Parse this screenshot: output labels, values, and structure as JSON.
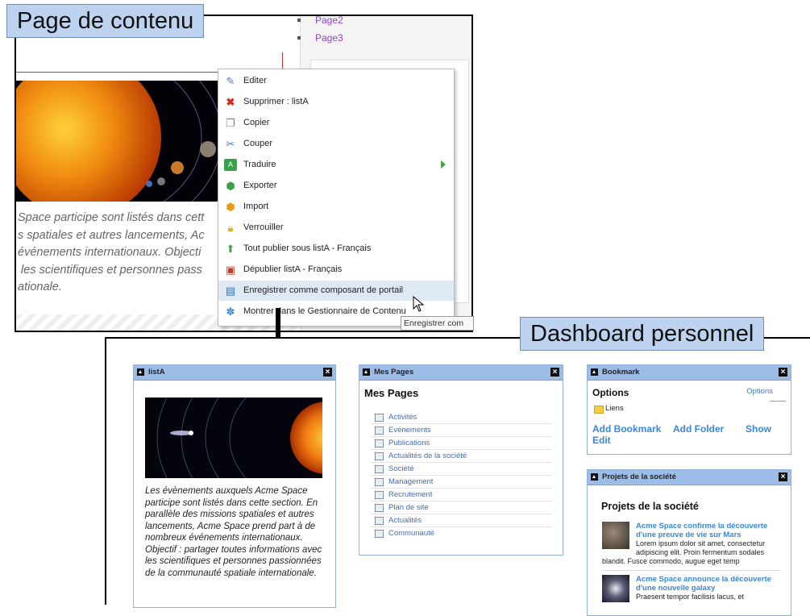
{
  "callouts": {
    "top": "Page de contenu",
    "bottom": "Dashboard personnel"
  },
  "content_page": {
    "nav_links": [
      "Page2",
      "Page3"
    ],
    "body_text_lines": [
      "Space participe sont listés dans cett",
      "s spatiales et autres lancements, Ac",
      "événements internationaux. Objecti",
      " les scientifiques et personnes pass",
      "ationale."
    ]
  },
  "context_menu": {
    "items": [
      {
        "label": "Editer",
        "icon": "edit-icon"
      },
      {
        "label": "Supprimer : listA",
        "icon": "delete-icon"
      },
      {
        "label": "Copier",
        "icon": "copy-icon"
      },
      {
        "label": "Couper",
        "icon": "cut-icon"
      },
      {
        "label": "Traduire",
        "icon": "translate-icon",
        "has_submenu": true
      },
      {
        "label": "Exporter",
        "icon": "export-icon"
      },
      {
        "label": "Import",
        "icon": "import-icon"
      },
      {
        "label": "Verrouiller",
        "icon": "lock-icon"
      },
      {
        "label": "Tout publier sous listA - Français",
        "icon": "publish-icon"
      },
      {
        "label": "Dépublier listA - Français",
        "icon": "unpublish-icon"
      },
      {
        "label": "Enregistrer comme composant de portail",
        "icon": "portal-icon",
        "highlighted": true
      },
      {
        "label": "Montrer dans le Gestionnaire de Contenu",
        "icon": "content-manager-icon"
      }
    ],
    "tooltip": "Enregistrer com"
  },
  "dashboard": {
    "lista": {
      "title": "listA",
      "text": "Les évènements auxquels Acme Space participe sont listés dans cette section. En parallèle des missions spatiales et autres lancements, Acme Space prend part à de nombreux événements internationaux. Objectif : partager toutes informations avec les scientifiques et personnes passionnées de la communauté spatiale internationale."
    },
    "mes_pages": {
      "title": "Mes Pages",
      "heading": "Mes Pages",
      "items": [
        "Activités",
        "Evénements",
        "Publications",
        "Actualités de la société",
        "Société",
        "Management",
        "Recrutement",
        "Plan de site",
        "Actualités",
        "Communauté"
      ]
    },
    "bookmark": {
      "title": "Bookmark",
      "options_heading": "Options",
      "options_link": "Options",
      "folder": "Liens",
      "add_bookmark": "Add Bookmark",
      "add_folder": "Add Folder",
      "show": "Show",
      "edit": "Edit"
    },
    "projets": {
      "title": "Projets de la société",
      "heading": "Projets de la société",
      "items": [
        {
          "title": "Acme Space confirme la découverte d'une preuve de vie sur Mars",
          "body_indented": "Lorem ipsum dolor sit amet, consectetur adipiscing elit. Proin fermentum sodales",
          "body_full": "blandit. Fusce commodo, augue eget temp"
        },
        {
          "title": "Acme Space announce la découverte d'une nouvelle galaxy",
          "body_indented": "Praesent tempor facilisis lacus, et",
          "body_full": ""
        }
      ]
    }
  },
  "colors": {
    "callout_bg": "#bcd2ee",
    "gadget_header": "#9ebde6",
    "link_blue": "#3a86d8",
    "menu_highlight": "#dfe9f4"
  }
}
